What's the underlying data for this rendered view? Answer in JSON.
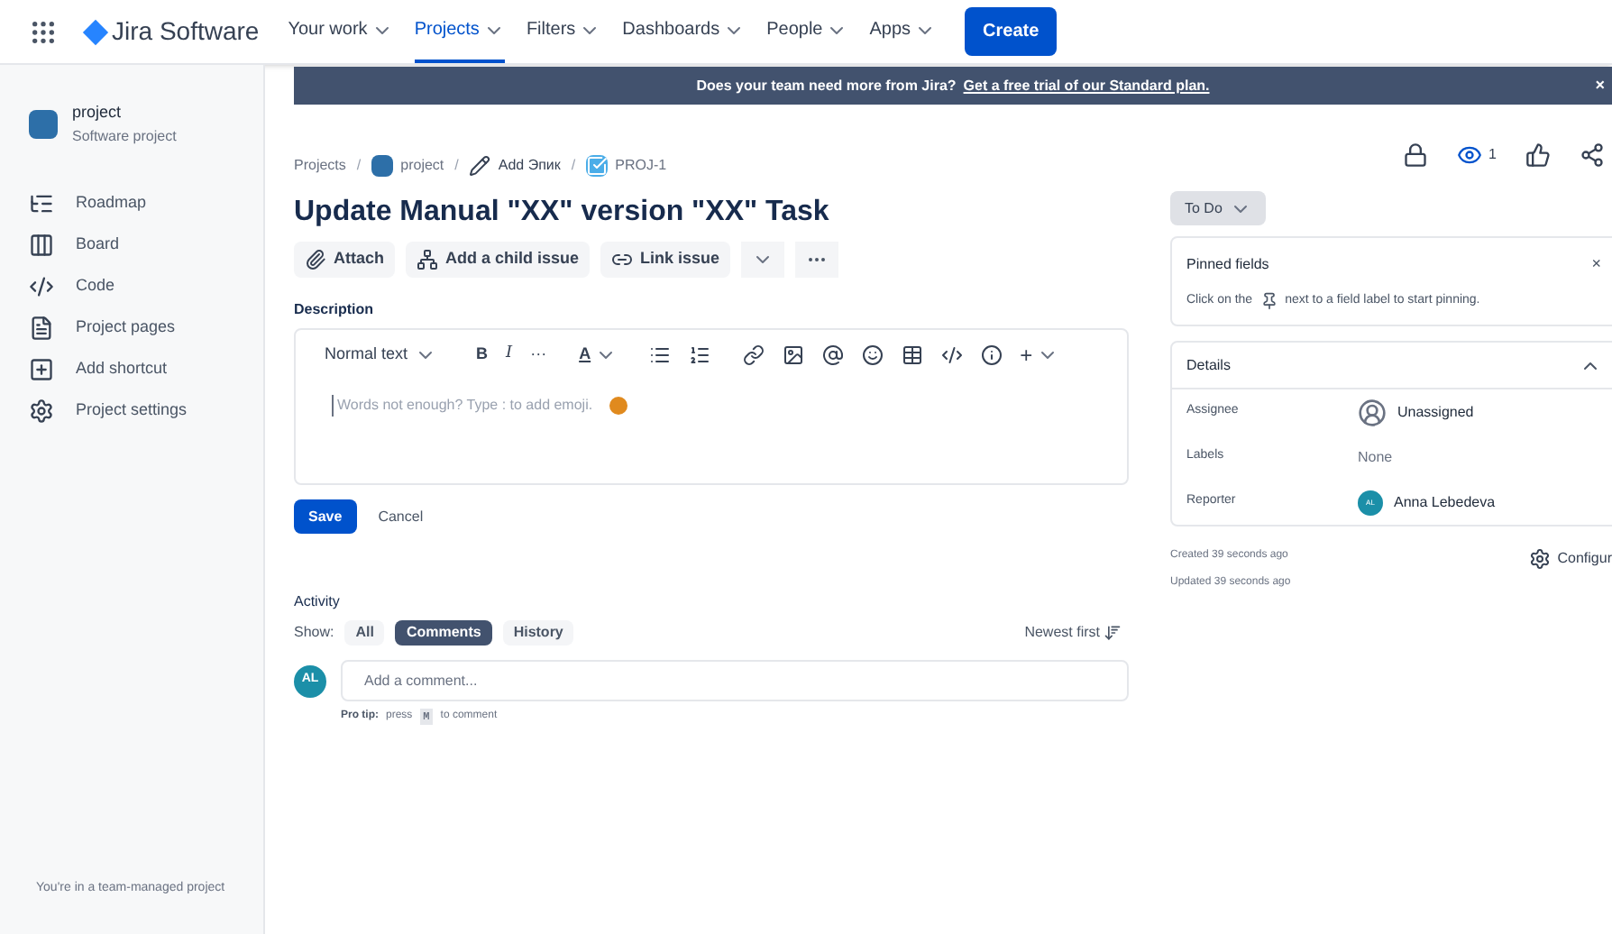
{
  "header": {
    "product": "Jira Software",
    "nav": [
      {
        "label": "Your work",
        "selected": false
      },
      {
        "label": "Projects",
        "selected": true
      },
      {
        "label": "Filters",
        "selected": false
      },
      {
        "label": "Dashboards",
        "selected": false
      },
      {
        "label": "People",
        "selected": false
      },
      {
        "label": "Apps",
        "selected": false
      }
    ],
    "create": "Create"
  },
  "sidebar": {
    "project": {
      "name": "project",
      "type": "Software project"
    },
    "items": [
      {
        "label": "Roadmap",
        "kind": "roadmap"
      },
      {
        "label": "Board",
        "kind": "board"
      },
      {
        "label": "Code",
        "kind": "code"
      },
      {
        "label": "Project pages",
        "kind": "pages"
      },
      {
        "label": "Add shortcut",
        "kind": "shortcut"
      },
      {
        "label": "Project settings",
        "kind": "settings"
      }
    ],
    "footer": "You're in a team-managed project"
  },
  "banner": {
    "text": "Does your team need more from Jira?",
    "link": "Get a free trial of our Standard plan.",
    "close": "×"
  },
  "breadcrumbs": [
    {
      "label": "Projects",
      "kind": "plain"
    },
    {
      "label": "project",
      "kind": "project",
      "separator": "/"
    },
    {
      "label": "Add Эпик",
      "kind": "epic",
      "separator": "/"
    },
    {
      "label": "PROJ-1",
      "kind": "task",
      "separator": "/"
    }
  ],
  "issue": {
    "title": "Update Manual \"XX\" version \"XX\" Task",
    "actions": [
      "Attach",
      "Add a child issue",
      "Link issue"
    ],
    "description": {
      "label": "Description",
      "style": "Normal text",
      "marks": [
        "B",
        "I",
        "···"
      ],
      "color_mark": "A",
      "insert": "+",
      "placeholder": "Words not enough? Type : to add emoji."
    },
    "save": "Save",
    "cancel": "Cancel"
  },
  "activity": {
    "title": "Activity",
    "show": "Show:",
    "filters": [
      {
        "label": "All",
        "selected": false
      },
      {
        "label": "Comments",
        "selected": true
      },
      {
        "label": "History",
        "selected": false
      }
    ],
    "sort": "Newest first",
    "avatar": "AL",
    "comment_placeholder": "Add a comment...",
    "tip": {
      "lead": "Pro tip:",
      "before": "press",
      "key": "M",
      "after": "to comment"
    }
  },
  "toolbar": {
    "watchers": "1"
  },
  "status": "To Do",
  "pinned": {
    "title": "Pinned fields",
    "close": "×",
    "hint_before": "Click on the",
    "hint_after": "next to a field label to start pinning."
  },
  "details": {
    "title": "Details",
    "expanded": true,
    "fields": [
      {
        "label": "Assignee",
        "value": "Unassigned",
        "kind": "unassigned"
      },
      {
        "label": "Labels",
        "value": "None",
        "kind": "plain"
      },
      {
        "label": "Reporter",
        "value": "Anna Lebedeva",
        "kind": "user",
        "avatar": "AL"
      }
    ]
  },
  "meta": {
    "created": "Created 39 seconds ago",
    "updated": "Updated 39 seconds ago",
    "configure": "Configur"
  }
}
